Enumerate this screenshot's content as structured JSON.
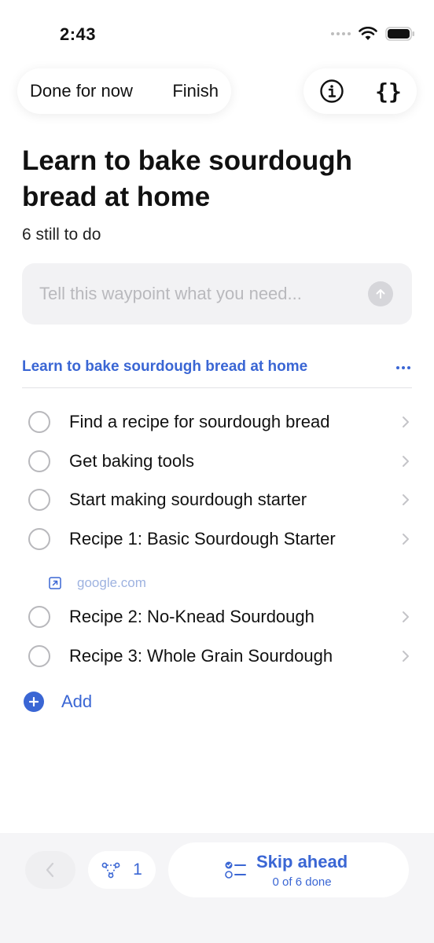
{
  "status_bar": {
    "time": "2:43"
  },
  "top_bar": {
    "done_for_now": "Done for now",
    "finish": "Finish",
    "info_icon": "info-icon",
    "code_icon": "braces-icon",
    "braces_glyph": "{}"
  },
  "header": {
    "title": "Learn to bake sourdough bread at home",
    "subtitle": "6 still to do"
  },
  "ask": {
    "placeholder": "Tell this waypoint what you need..."
  },
  "section": {
    "title": "Learn to bake sourdough bread at home"
  },
  "tasks": [
    {
      "label": "Find a recipe for sourdough bread"
    },
    {
      "label": "Get baking tools"
    },
    {
      "label": "Start making sourdough starter"
    },
    {
      "label": "Recipe 1: Basic Sourdough Starter"
    },
    {
      "label": "Recipe 2: No-Knead Sourdough"
    },
    {
      "label": "Recipe 3: Whole Grain Sourdough"
    }
  ],
  "link": {
    "text": "google.com"
  },
  "add": {
    "label": "Add"
  },
  "bottom_bar": {
    "branch_count": "1",
    "skip_title": "Skip ahead",
    "skip_sub": "0 of 6 done"
  },
  "colors": {
    "accent": "#3a66d4",
    "muted": "#b8b8bc",
    "bar_bg": "#f5f5f7"
  }
}
